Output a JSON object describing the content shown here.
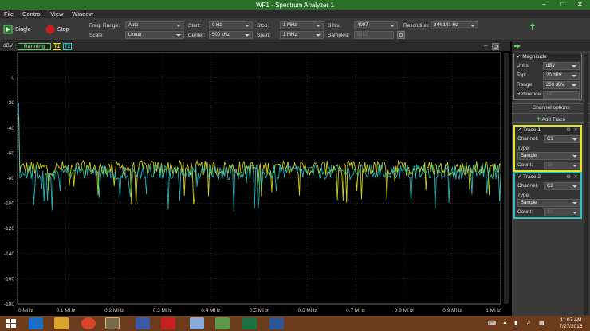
{
  "window": {
    "title": "WF1 - Spectrum Analyzer 1"
  },
  "menu": [
    "File",
    "Control",
    "View",
    "Window"
  ],
  "toolbar": {
    "single_label": "Single",
    "stop_label": "Stop",
    "freq_range_label": "Freq. Range:",
    "freq_range_value": "Auto",
    "scale_label": "Scale:",
    "scale_value": "Linear",
    "start_label": "Start:",
    "start_value": "0 Hz",
    "center_label": "Center:",
    "center_value": "500 kHz",
    "stop_field_label": "Stop:",
    "stop_value": "1 MHz",
    "span_label": "Span:",
    "span_value": "1 MHz",
    "bins_label": "BINs:",
    "bins_value": "4097",
    "samples_label": "Samples:",
    "samples_value": "8192",
    "resolution_label": "Resolution:",
    "resolution_value": "244.141 Hz"
  },
  "status": {
    "unit": "dBV",
    "state": "Running",
    "t1": "T1",
    "t2": "T2"
  },
  "panel": {
    "magnitude": {
      "title": "Magnitude",
      "units_label": "Units:",
      "units_value": "dBV",
      "top_label": "Top:",
      "top_value": "20 dBV",
      "range_label": "Range:",
      "range_value": "200 dBV",
      "reference_label": "Reference:",
      "reference_value": "1V"
    },
    "channel_options": "Channel options",
    "add_trace": "Add Trace",
    "trace1": {
      "title": "Trace 1",
      "channel_label": "Channel:",
      "channel_value": "C1",
      "type_label": "Type:",
      "type_value": "Sample",
      "count_label": "Count:",
      "count_value": "10",
      "color": "#e6e61a"
    },
    "trace2": {
      "title": "Trace 2",
      "channel_label": "Channel:",
      "channel_value": "C2",
      "type_label": "Type:",
      "type_value": "Sample",
      "count_label": "Count:",
      "count_value": "10",
      "color": "#2ec4c4"
    }
  },
  "chart_data": {
    "type": "line",
    "xlabel": "",
    "ylabel": "dBV",
    "xlim": [
      0,
      1
    ],
    "ylim": [
      -180,
      20
    ],
    "x_ticks": [
      "0 MHz",
      "0.1 MHz",
      "0.2 MHz",
      "0.3 MHz",
      "0.4 MHz",
      "0.5 MHz",
      "0.6 MHz",
      "0.7 MHz",
      "0.8 MHz",
      "0.9 MHz",
      "1 MHz"
    ],
    "y_ticks": [
      "0",
      "-20",
      "-40",
      "-60",
      "-80",
      "-100",
      "-120",
      "-140",
      "-160",
      "-180"
    ],
    "grid": true,
    "series": [
      {
        "name": "Trace 1",
        "color": "#e6e61a",
        "level": -72
      },
      {
        "name": "Trace 2",
        "color": "#2ec4c4",
        "level": -75
      }
    ]
  },
  "taskbar": {
    "time": "11:07 AM",
    "date": "7/27/2016"
  }
}
